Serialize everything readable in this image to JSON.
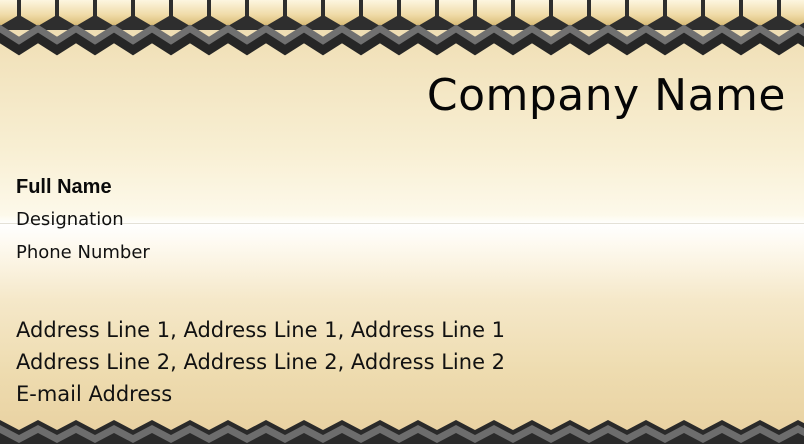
{
  "card": {
    "company_name": "Company Name",
    "full_name": "Full Name",
    "designation": "Designation",
    "phone": "Phone Number",
    "address_line_1": "Address Line 1,  Address Line 1,  Address Line 1",
    "address_line_2": "Address Line 2,  Address Line 2,  Address Line 2",
    "email": "E-mail Address"
  },
  "colors": {
    "gold_light": "#f8efd3",
    "gold": "#e8d09f",
    "zigzag_dark": "#2b2b2b",
    "zigzag_gray": "#6b6b6b"
  }
}
